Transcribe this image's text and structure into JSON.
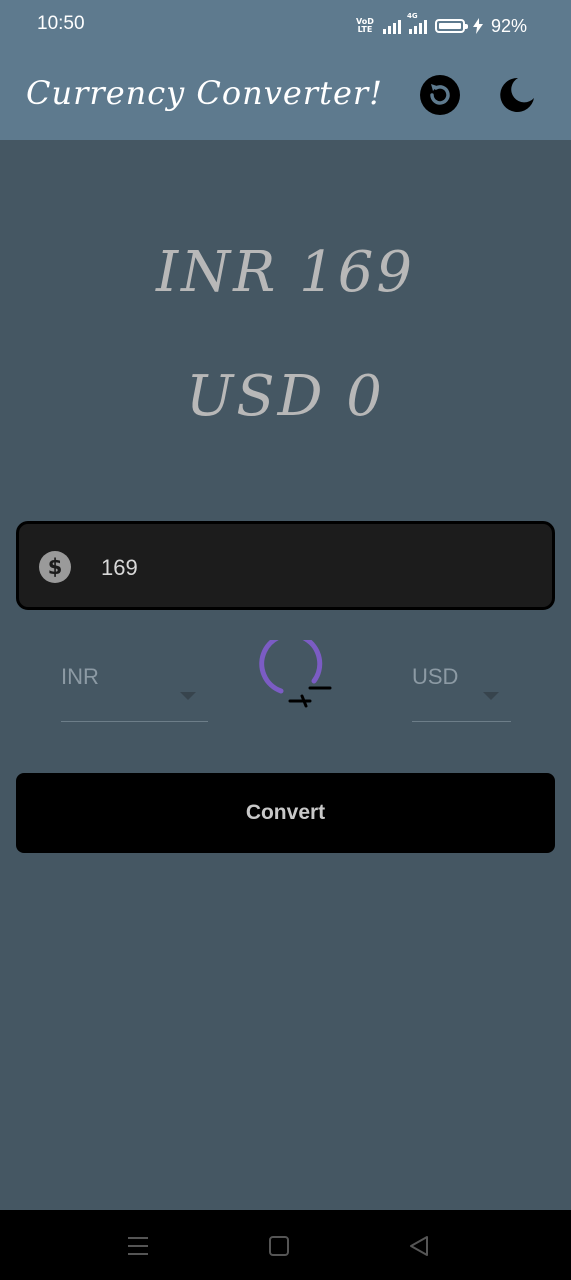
{
  "status": {
    "time": "10:50",
    "volte": "VoD LTE",
    "network": "4G",
    "battery_percent": "92%"
  },
  "appbar": {
    "title": "Currency Converter!",
    "icons": [
      "refresh-icon",
      "moon-icon"
    ]
  },
  "display": {
    "from_amount": "INR 169",
    "to_amount": "USD 0"
  },
  "input": {
    "value": "169",
    "icon": "dollar-icon"
  },
  "selectors": {
    "from_currency": "INR",
    "to_currency": "USD"
  },
  "convert_button": {
    "label": "Convert"
  },
  "navbar": {
    "icons": [
      "menu-icon",
      "home-icon",
      "back-icon"
    ]
  },
  "colors": {
    "app_bar": "#5e7a8e",
    "background": "#455763",
    "accent": "#7b5cc4",
    "button": "#000000"
  }
}
